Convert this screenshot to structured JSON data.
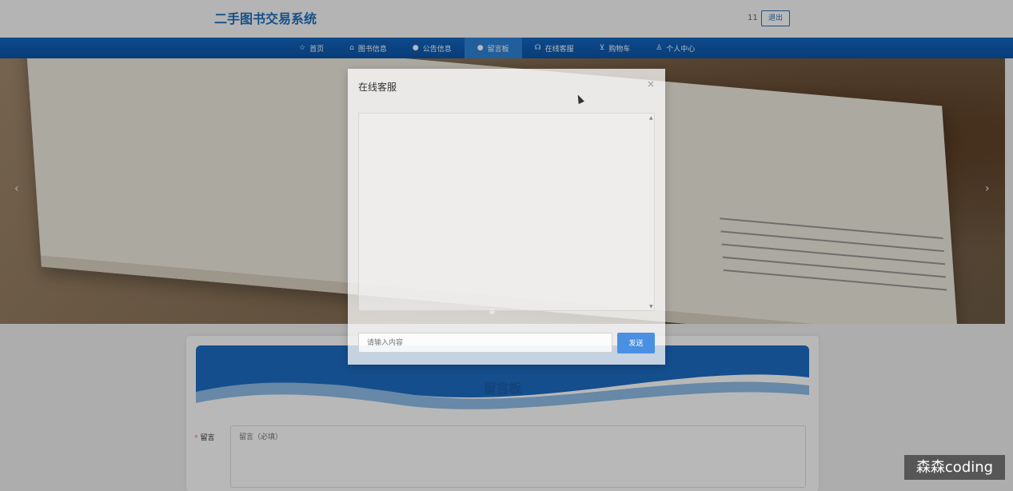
{
  "header": {
    "site_title": "二手图书交易系统",
    "user_name": "11",
    "logout_label": "退出"
  },
  "nav": {
    "items": [
      {
        "label": "首页",
        "icon": "star-icon",
        "glyph": "☆"
      },
      {
        "label": "图书信息",
        "icon": "home-icon",
        "glyph": "⌂"
      },
      {
        "label": "公告信息",
        "icon": "info-icon",
        "glyph": "●"
      },
      {
        "label": "留言板",
        "icon": "question-icon",
        "glyph": "●"
      },
      {
        "label": "在线客服",
        "icon": "headset-icon",
        "glyph": "☊"
      },
      {
        "label": "购物车",
        "icon": "cart-icon",
        "glyph": "⊻"
      },
      {
        "label": "个人中心",
        "icon": "user-icon",
        "glyph": "♙"
      }
    ],
    "active_index": 3
  },
  "banner": {
    "prev_glyph": "‹",
    "next_glyph": "›"
  },
  "message_board": {
    "title": "留言板",
    "required_mark": "*",
    "message_label": "留言",
    "message_placeholder": "留言（必填）"
  },
  "dialog": {
    "title": "在线客服",
    "close_glyph": "×",
    "input_placeholder": "请输入内容",
    "send_label": "发送"
  },
  "watermark": {
    "text": "森森coding"
  },
  "colors": {
    "brand": "#1f6fbf",
    "nav": "#0b55a8",
    "send_button": "#4a90e2"
  }
}
